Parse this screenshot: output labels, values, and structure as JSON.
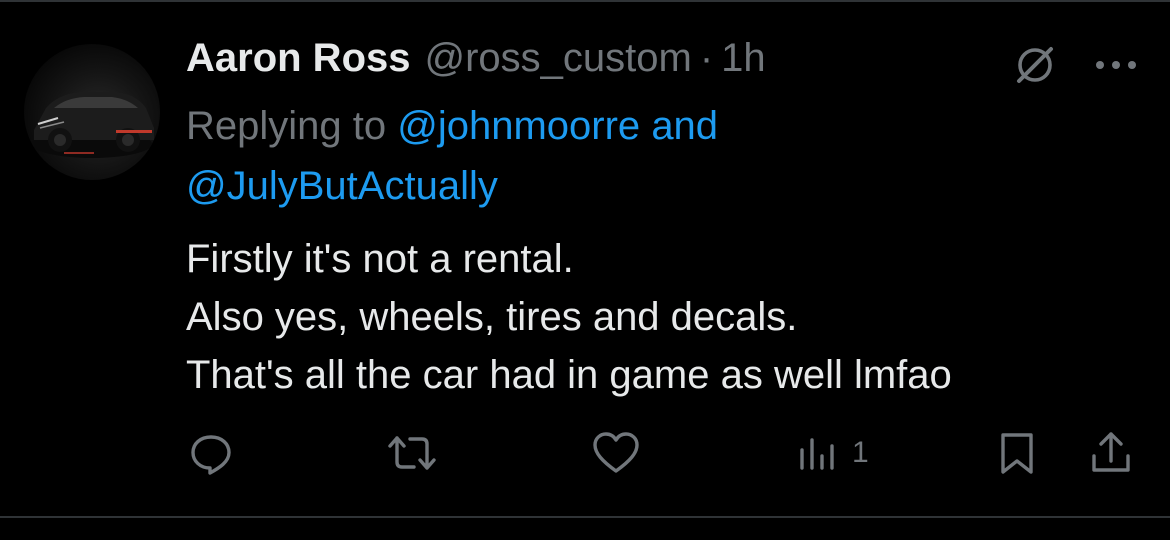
{
  "tweet": {
    "author_name": "Aaron Ross",
    "author_handle": "@ross_custom",
    "separator": "·",
    "timestamp": "1h",
    "replying_prefix": "Replying to",
    "replying_mention_1": "@johnmoorre",
    "replying_conjunction": "and",
    "replying_mention_2": "@JulyButActually",
    "body_lines": [
      "Firstly it's not a rental.",
      "Also yes, wheels, tires and decals.",
      "That's all the car had in game as well lmfao"
    ]
  },
  "actions": {
    "reply_icon": "reply-icon",
    "retweet_icon": "retweet-icon",
    "like_icon": "heart-icon",
    "views_icon": "analytics-icon",
    "views_count": "1",
    "bookmark_icon": "bookmark-icon",
    "share_icon": "share-icon"
  },
  "top_icons": {
    "grok_icon": "grok-icon",
    "more_icon": "more-icon"
  },
  "colors": {
    "background": "#000000",
    "text_primary": "#e7e9ea",
    "text_secondary": "#71767b",
    "link": "#1d9bf0",
    "divider": "#2f3336"
  }
}
